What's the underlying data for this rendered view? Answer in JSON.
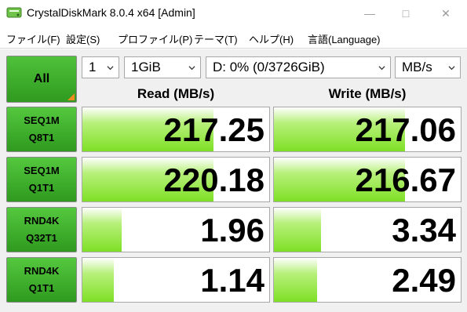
{
  "window": {
    "title": "CrystalDiskMark 8.0.4 x64 [Admin]",
    "controls": {
      "minimize": "—",
      "maximize": "□",
      "close": "✕"
    }
  },
  "menu": [
    "ファイル(F)",
    "設定(S)",
    "プロファイル(P)",
    "テーマ(T)",
    "ヘルプ(H)",
    "言語(Language)"
  ],
  "toolbar": {
    "all_label": "All",
    "count": "1",
    "size": "1GiB",
    "drive": "D: 0% (0/3726GiB)",
    "unit": "MB/s"
  },
  "headers": {
    "read": "Read (MB/s)",
    "write": "Write (MB/s)"
  },
  "rows": [
    {
      "line1": "SEQ1M",
      "line2": "Q8T1",
      "read": "217.25",
      "write": "217.06",
      "read_level": 0.7,
      "write_level": 0.7
    },
    {
      "line1": "SEQ1M",
      "line2": "Q1T1",
      "read": "220.18",
      "write": "216.67",
      "read_level": 0.7,
      "write_level": 0.7
    },
    {
      "line1": "RND4K",
      "line2": "Q32T1",
      "read": "1.96",
      "write": "3.34",
      "read_level": 0.21,
      "write_level": 0.25
    },
    {
      "line1": "RND4K",
      "line2": "Q1T1",
      "read": "1.14",
      "write": "2.49",
      "read_level": 0.17,
      "write_level": 0.23
    }
  ],
  "colors": {
    "accent_green": "#2f9a1f",
    "fill_green": "#7fe025",
    "corner_orange": "#f08c1e"
  },
  "icons": {
    "app": "disk-icon",
    "chevron": "chevron-down-icon"
  }
}
